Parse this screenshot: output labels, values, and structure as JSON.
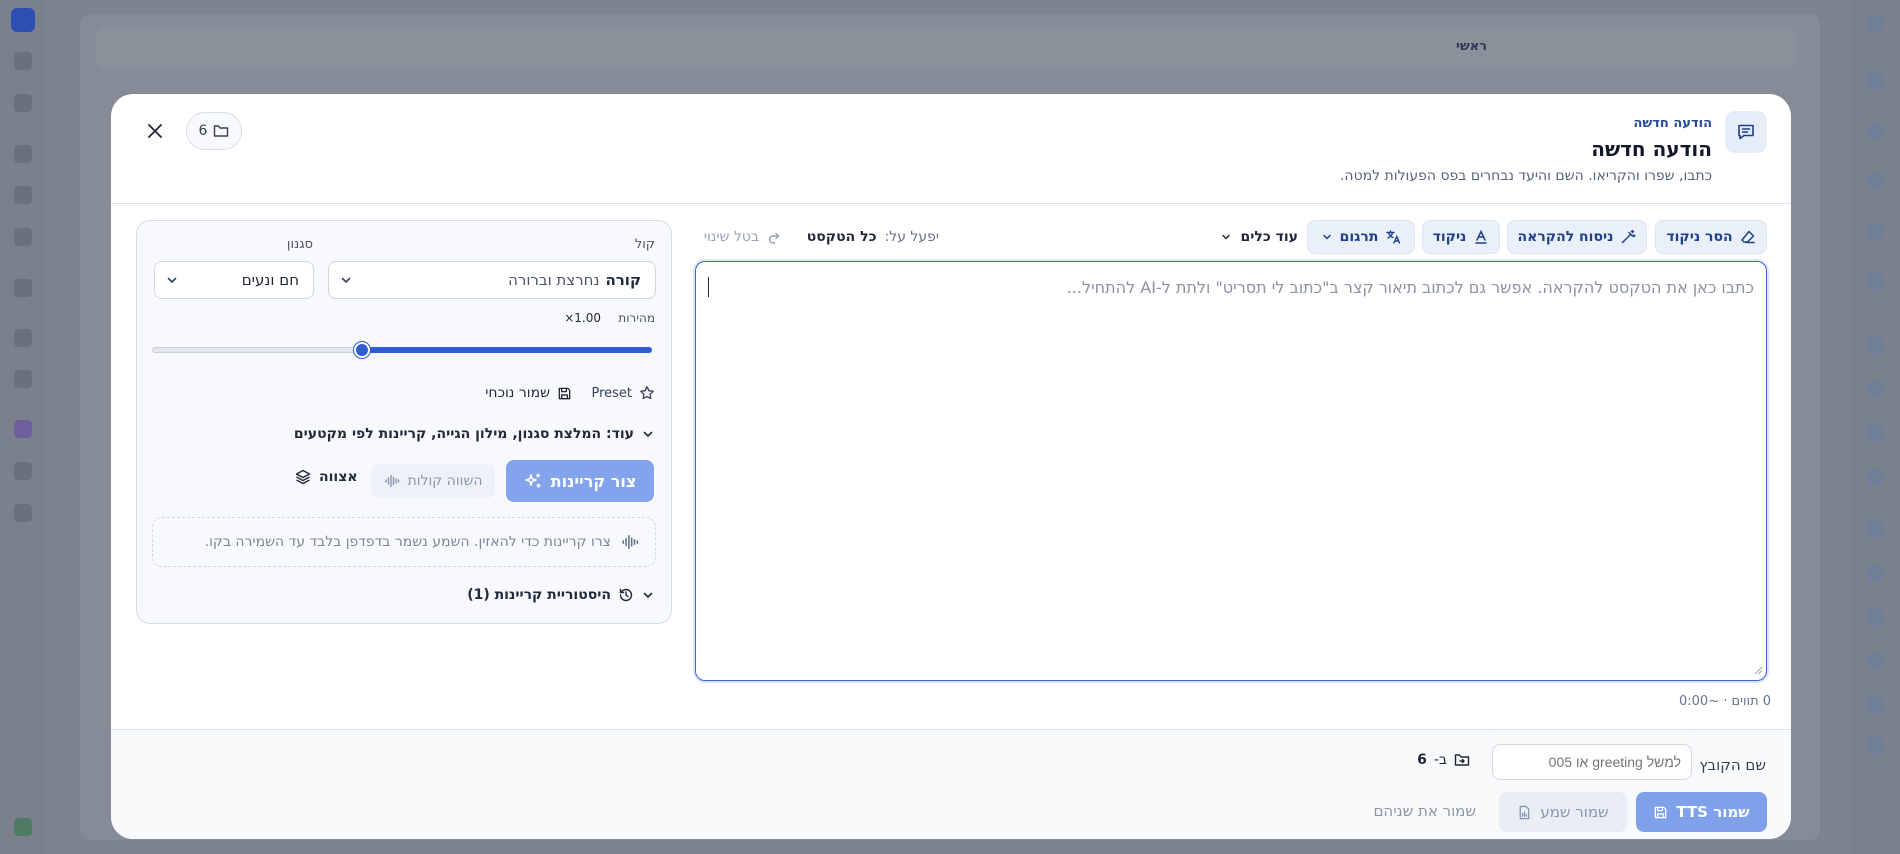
{
  "background": {
    "topbar_label": "ראשי"
  },
  "header": {
    "subtitle": "הודעה חדשה",
    "title": "הודעה חדשה",
    "description": "כתבו, שפרו והקריאו. השם והיעד נבחרים בפס הפעולות למטה.",
    "folder_count": "6",
    "close_icon": "close-icon"
  },
  "toolbar": {
    "remove_nikud": "הסר ניקוד",
    "read_version": "ניסוח להקראה",
    "nikud": "ניקוד",
    "translate": "תרגום",
    "more_tools": "עוד כלים",
    "apply_on_label": "יפעל על:",
    "apply_on_value": "כל הטקסט",
    "undo": "בטל שינוי"
  },
  "editor": {
    "placeholder": "כתבו כאן את הטקסט להקראה. אפשר גם לכתוב תיאור קצר ב\"כתוב לי תסריט\" ולתת ל-AI להתחיל...",
    "counter": "0 תווים · ~0:00"
  },
  "settings": {
    "voice_label": "קול",
    "voice_name": "קורה",
    "voice_desc": "נחרצת וברורה",
    "style_label": "סגנון",
    "style_value": "חם ונעים",
    "speed_label": "מהירות",
    "speed_value": "×1.00",
    "speed_fraction": 0.42,
    "preset_label": "Preset",
    "save_current": "שמור נוכחי",
    "more_options": "עוד: המלצת סגנון, מילון הגייה, קריינות לפי מקטעים",
    "generate_button": "צור קריינות",
    "compare_button": "השווה קולות",
    "team_button": "אצווה",
    "preview_hint": "צרו קריינות כדי להאזין. השמע נשמר בדפדפן בלבד עד השמירה בקו.",
    "history_label": "היסטוריית קריינות (1)"
  },
  "footer": {
    "filename_label": "שם הקובץ",
    "filename_placeholder": "למשל greeting או 005",
    "dest_prefix": "ב-",
    "dest_value": "6",
    "save_tts": "שמור TTS",
    "save_audio": "שמור שמע",
    "save_both": "שמור את שניהם"
  },
  "colors": {
    "accent": "#2f5bd3",
    "accent_light": "#83a4ec",
    "chip_bg": "#eaf0fa",
    "overlay": "#7c8490"
  }
}
